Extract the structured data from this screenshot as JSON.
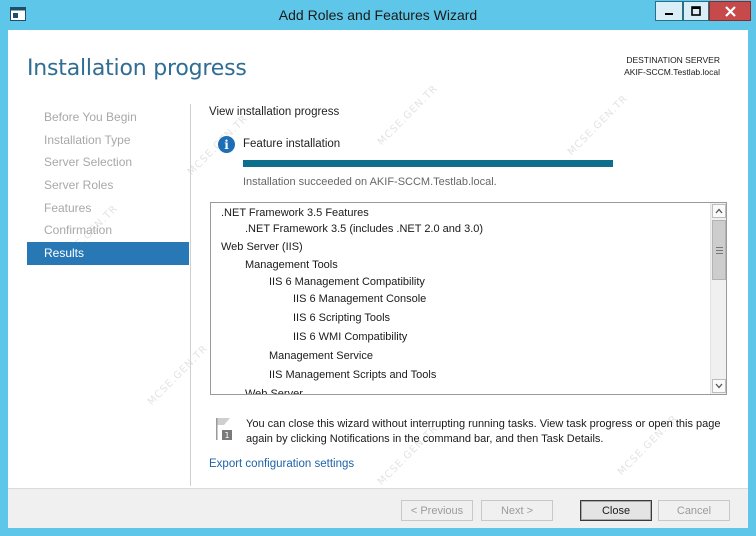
{
  "window": {
    "title": "Add Roles and Features Wizard"
  },
  "header": {
    "page_title": "Installation progress",
    "destination_label": "DESTINATION SERVER",
    "destination_server": "AKIF-SCCM.Testlab.local"
  },
  "nav": {
    "items": [
      {
        "label": "Before You Begin",
        "active": false
      },
      {
        "label": "Installation Type",
        "active": false
      },
      {
        "label": "Server Selection",
        "active": false
      },
      {
        "label": "Server Roles",
        "active": false
      },
      {
        "label": "Features",
        "active": false
      },
      {
        "label": "Confirmation",
        "active": false
      },
      {
        "label": "Results",
        "active": true
      }
    ]
  },
  "main": {
    "view_label": "View installation progress",
    "feature_label": "Feature installation",
    "progress_percent": 100,
    "status_text": "Installation succeeded on AKIF-SCCM.Testlab.local.",
    "results": [
      {
        "text": ".NET Framework 3.5 Features",
        "level": 0
      },
      {
        "text": ".NET Framework 3.5 (includes .NET 2.0 and 3.0)",
        "level": 1
      },
      {
        "text": "Web Server (IIS)",
        "level": 0
      },
      {
        "text": "Management Tools",
        "level": 1
      },
      {
        "text": "IIS 6 Management Compatibility",
        "level": 2
      },
      {
        "text": "IIS 6 Management Console",
        "level": 3
      },
      {
        "text": "IIS 6 Scripting Tools",
        "level": 3
      },
      {
        "text": "IIS 6 WMI Compatibility",
        "level": 3
      },
      {
        "text": "Management Service",
        "level": 2
      },
      {
        "text": "IIS Management Scripts and Tools",
        "level": 2
      },
      {
        "text": "Web Server",
        "level": 1
      }
    ],
    "note": "You can close this wizard without interrupting running tasks. View task progress or open this page again by clicking Notifications in the command bar, and then Task Details.",
    "export_link": "Export configuration settings"
  },
  "footer": {
    "previous": "< Previous",
    "next": "Next >",
    "close": "Close",
    "cancel": "Cancel"
  },
  "watermark": "MCSE.GEN.TR",
  "colors": {
    "titlebar": "#5ec7e9",
    "title_blue": "#2f6d94",
    "nav_active": "#2778b5",
    "progress_fill": "#0c6f8c",
    "link": "#1d63a8"
  }
}
